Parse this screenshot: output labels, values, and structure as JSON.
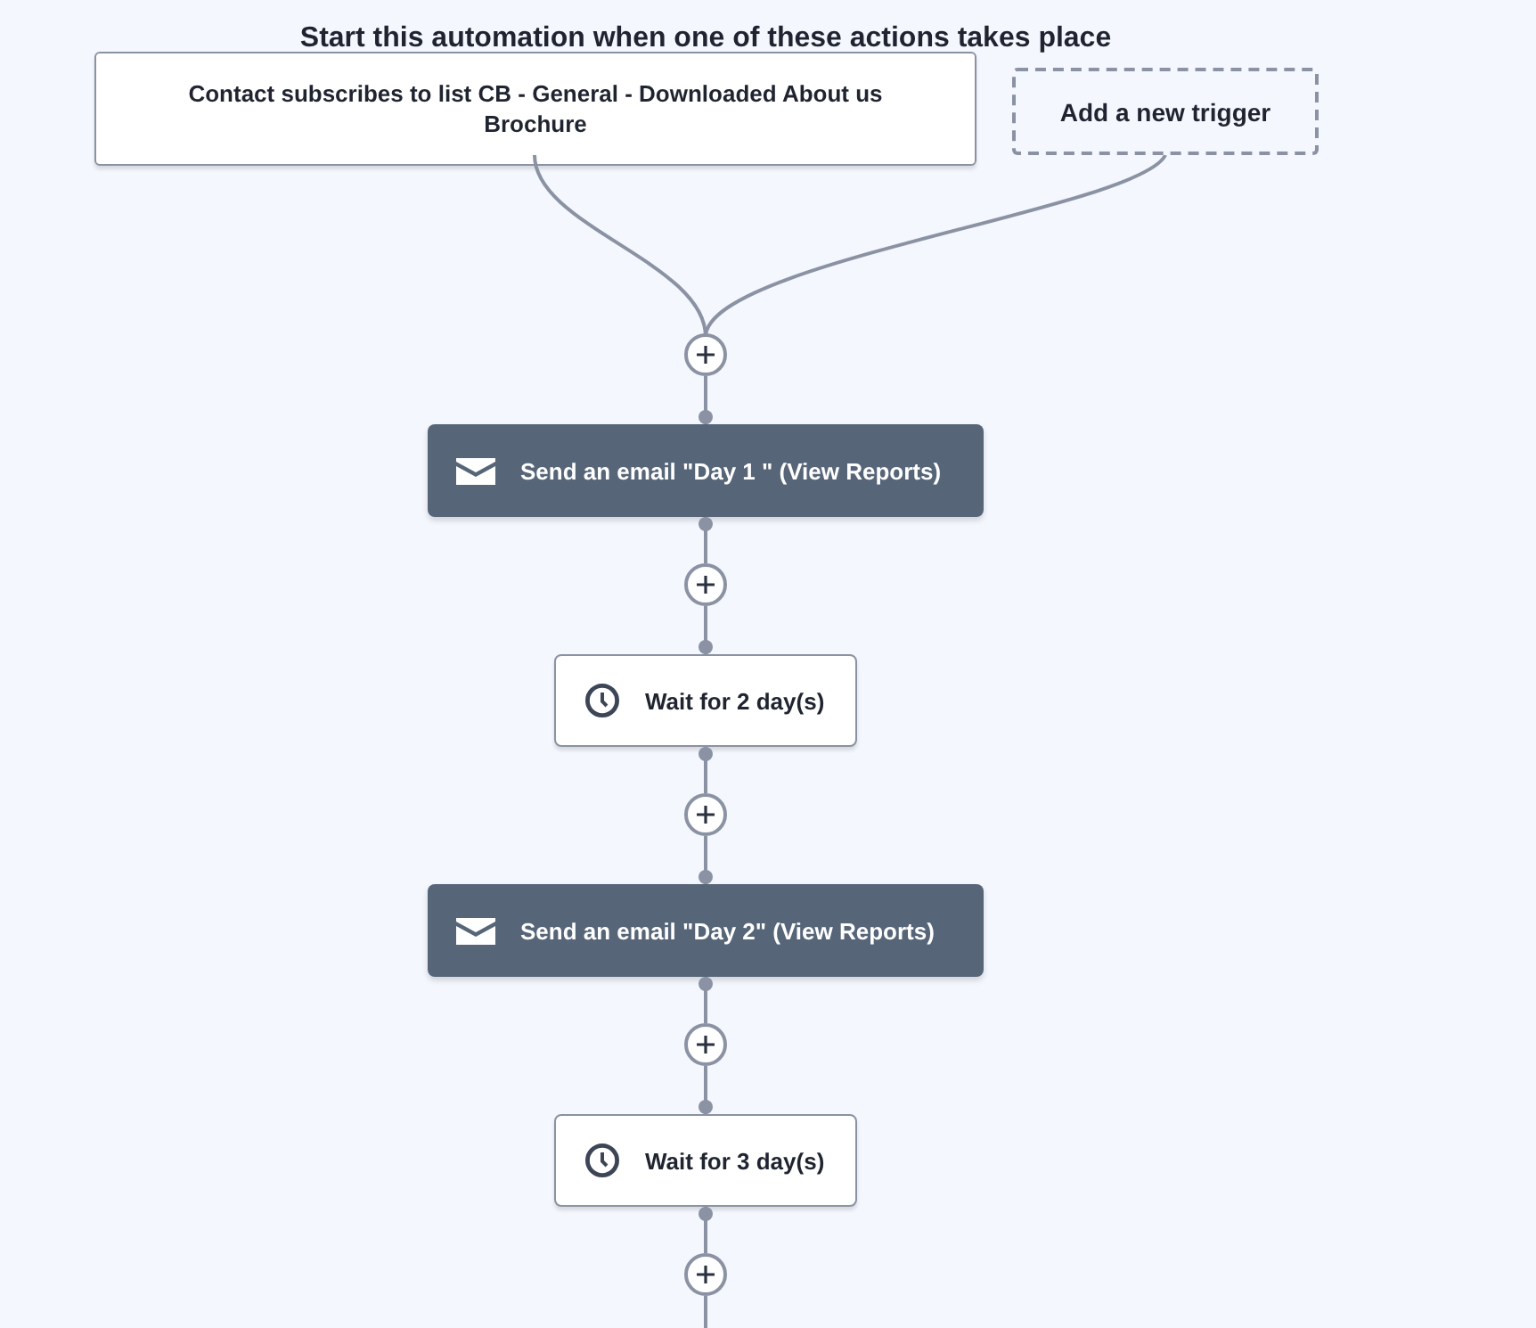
{
  "title": "Start this automation when one of these actions takes place",
  "triggers": [
    {
      "kind": "trigger",
      "label": "Contact subscribes to list CB - General - Downloaded About us Brochure"
    },
    {
      "kind": "add",
      "label": "Add a new trigger"
    }
  ],
  "steps": [
    {
      "kind": "email",
      "label": "Send an email \"Day 1 \" (View Reports)"
    },
    {
      "kind": "wait",
      "label": "Wait for 2 day(s)"
    },
    {
      "kind": "email",
      "label": "Send an email \"Day 2\" (View Reports)"
    },
    {
      "kind": "wait",
      "label": "Wait for 3 day(s)"
    }
  ]
}
